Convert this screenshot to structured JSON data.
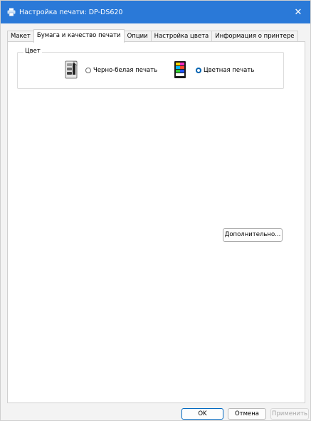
{
  "window": {
    "title": "Настройка печати: DP-DS620",
    "close_glyph": "✕"
  },
  "tabs": [
    {
      "label": "Макет",
      "active": false
    },
    {
      "label": "Бумага и качество печати",
      "active": true
    },
    {
      "label": "Опции",
      "active": false
    },
    {
      "label": "Настройка цвета",
      "active": false
    },
    {
      "label": "Информация о принтере",
      "active": false
    }
  ],
  "color_group": {
    "legend": "Цвет",
    "options": [
      {
        "label": "Черно-белая печать",
        "selected": false,
        "icon": "monochrome-printer-icon"
      },
      {
        "label": "Цветная печать",
        "selected": true,
        "icon": "color-printer-icon"
      }
    ]
  },
  "advanced_button": "Дополнительно...",
  "footer": {
    "ok": "OK",
    "cancel": "Отмена",
    "apply": "Применить"
  },
  "colors": {
    "titlebar": "#2a79d8",
    "accent": "#0063b1",
    "disabled_text": "#a6a6a6"
  }
}
